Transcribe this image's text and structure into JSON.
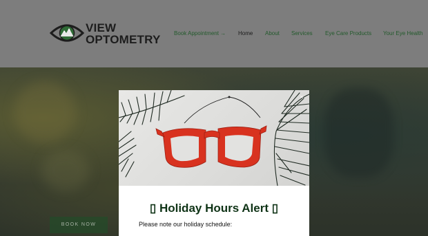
{
  "header": {
    "logo": {
      "line1": "VIEW",
      "line2": "OPTOMETRY"
    },
    "nav": [
      {
        "label": "Book Appointment →",
        "active": false
      },
      {
        "label": "Home",
        "active": true
      },
      {
        "label": "About",
        "active": false
      },
      {
        "label": "Services",
        "active": false
      },
      {
        "label": "Eye Care Products",
        "active": false
      },
      {
        "label": "Your Eye Health",
        "active": false
      }
    ]
  },
  "hero": {
    "book_button": "BOOK NOW"
  },
  "modal": {
    "close": "×",
    "title": "▯ Holiday Hours Alert ▯",
    "body": "Please note our holiday schedule:"
  },
  "colors": {
    "brand_green": "#235a2c",
    "header_bg": "#7d7d7d",
    "frame_red": "#d8321f"
  }
}
